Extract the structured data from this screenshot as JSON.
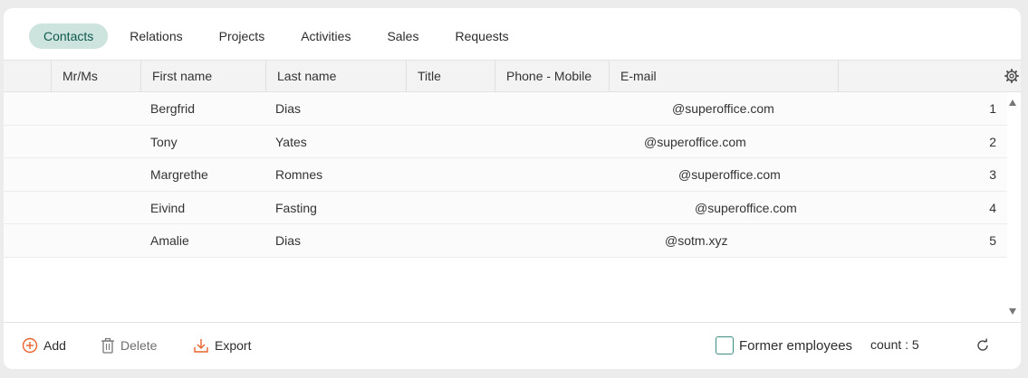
{
  "tabs": [
    {
      "label": "Contacts",
      "active": true
    },
    {
      "label": "Relations",
      "active": false
    },
    {
      "label": "Projects",
      "active": false
    },
    {
      "label": "Activities",
      "active": false
    },
    {
      "label": "Sales",
      "active": false
    },
    {
      "label": "Requests",
      "active": false
    }
  ],
  "columns": {
    "mrms": "Mr/Ms",
    "first_name": "First name",
    "last_name": "Last name",
    "title": "Title",
    "phone_mobile": "Phone - Mobile",
    "email": "E-mail"
  },
  "rows": [
    {
      "first_name": "Bergfrid",
      "last_name": "Dias",
      "email": "@superoffice.com",
      "rank": "1"
    },
    {
      "first_name": "Tony",
      "last_name": "Yates",
      "email": "@superoffice.com",
      "rank": "2"
    },
    {
      "first_name": "Margrethe",
      "last_name": "Romnes",
      "email": "@superoffice.com",
      "rank": "3"
    },
    {
      "first_name": "Eivind",
      "last_name": "Fasting",
      "email": "@superoffice.com",
      "rank": "4"
    },
    {
      "first_name": "Amalie",
      "last_name": "Dias",
      "email": "@sotm.xyz",
      "rank": "5"
    }
  ],
  "footer": {
    "add_label": "Add",
    "delete_label": "Delete",
    "export_label": "Export",
    "former_employees_label": "Former employees",
    "former_employees_checked": false,
    "count_text": "count : 5"
  },
  "icons": {
    "settings": "gear-icon",
    "add": "plus-circle-icon",
    "delete": "trash-icon",
    "export": "download-icon",
    "refresh": "refresh-icon",
    "scroll_up": "triangle-up-icon",
    "scroll_down": "triangle-down-icon"
  },
  "colors": {
    "accent": "#3e8b80",
    "active_tab_bg": "#cde3de",
    "add_icon": "#e8632c",
    "export_icon": "#e8632c"
  }
}
